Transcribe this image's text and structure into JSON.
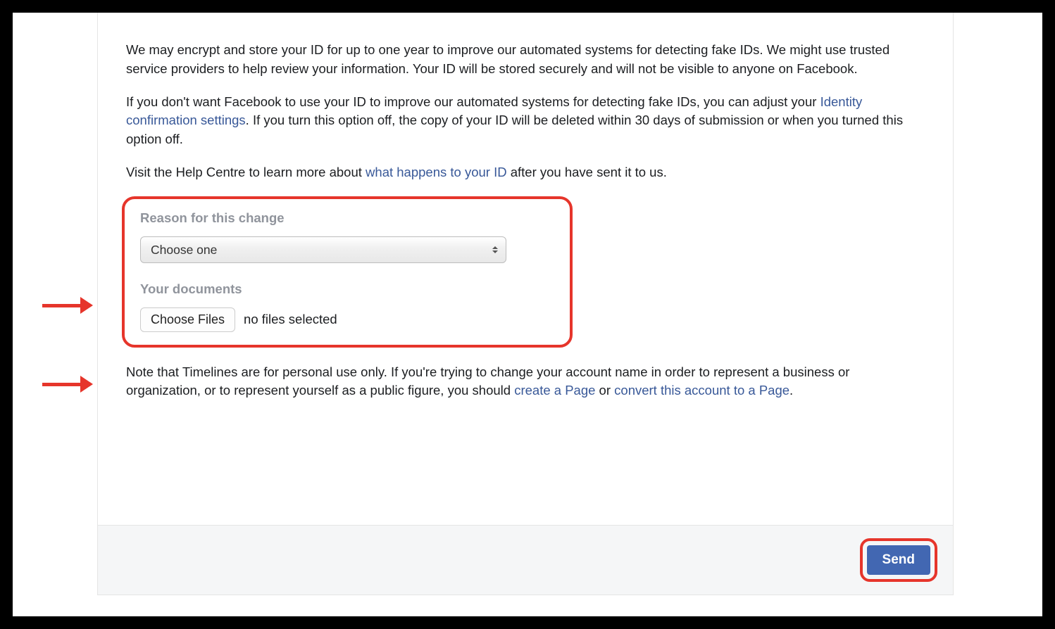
{
  "body": {
    "p1": "We may encrypt and store your ID for up to one year to improve our automated systems for detecting fake IDs. We might use trusted service providers to help review your information. Your ID will be stored securely and will not be visible to anyone on Facebook.",
    "p2_pre": "If you don't want Facebook to use your ID to improve our automated systems for detecting fake IDs, you can adjust your ",
    "p2_link": "Identity confirmation settings",
    "p2_post": ". If you turn this option off, the copy of your ID will be deleted within 30 days of submission or when you turned this option off.",
    "p3_pre": "Visit the Help Centre to learn more about ",
    "p3_link": "what happens to your ID",
    "p3_post": " after you have sent it to us.",
    "note_pre": "Note that Timelines are for personal use only. If you're trying to change your account name in order to represent a business or organization, or to represent yourself as a public figure, you should ",
    "note_link1": "create a Page",
    "note_mid": " or ",
    "note_link2": "convert this account to a Page",
    "note_post": "."
  },
  "form": {
    "reason_label": "Reason for this change",
    "reason_placeholder": "Choose one",
    "documents_label": "Your documents",
    "choose_files_button": "Choose Files",
    "no_files_text": "no files selected"
  },
  "footer": {
    "send_button": "Send"
  }
}
